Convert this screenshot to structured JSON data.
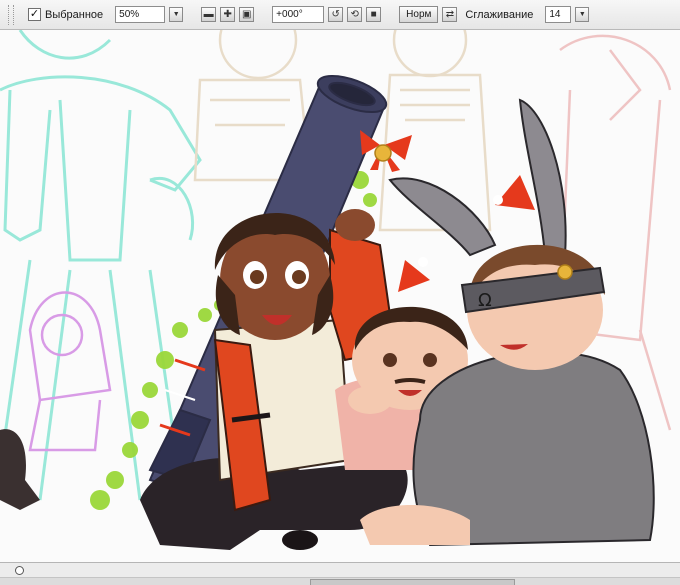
{
  "toolbar": {
    "selected_label": "Выбранное",
    "selected_checked": "✓",
    "zoom_value": "50%",
    "rotation_value": "+000°",
    "normal_label": "Норм",
    "smoothing_label": "Сглаживание",
    "smoothing_value": "14",
    "icons": [
      "grip-icon",
      "chevron-down-icon",
      "zoom-out-icon",
      "zoom-in-icon",
      "fit-icon",
      "rotate-left-icon",
      "rotate-reset-icon",
      "stop-icon",
      "flip-icon"
    ]
  },
  "canvas": {
    "artwork": "illustration",
    "colors": {
      "sketch_cyan": "#8fe6d6",
      "sketch_beige": "#e8dcc9",
      "sketch_pink": "#efc4c4",
      "sketch_magenta": "#d89be6",
      "red_shirt": "#e0471f",
      "vest": "#f3ecd9",
      "pants_dark": "#2a2328",
      "bazooka": "#4a4c70",
      "garland": "#9bd83a",
      "hoodie_gray": "#7f7d80",
      "ear_gray": "#8d8a90",
      "skin_dark": "#8a4a2e",
      "skin_light": "#f4c9b0",
      "hair_dark": "#3b2418",
      "hair_brown": "#7a4a2c",
      "ribbon_red": "#e5391c",
      "bell_gold": "#e8b53a"
    }
  },
  "statusbar": {
    "icons": [
      "navigator-circle-icon"
    ]
  }
}
